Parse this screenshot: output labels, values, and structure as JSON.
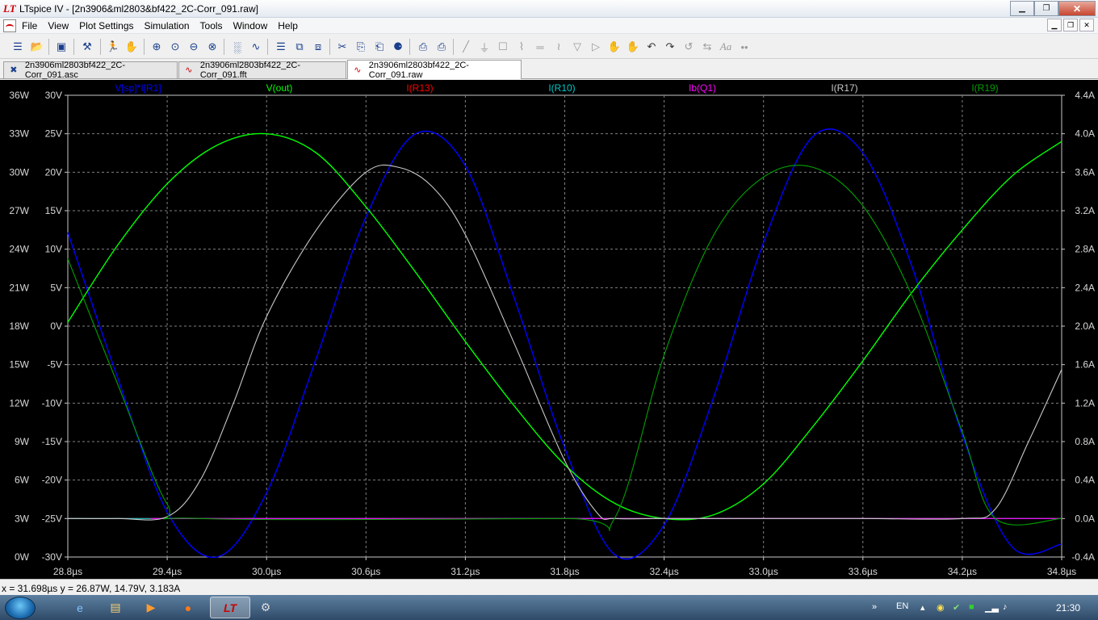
{
  "window": {
    "title": "LTspice IV - [2n3906&ml2803&bf422_2C-Corr_091.raw]",
    "app_icon": "ltspice-logo-icon"
  },
  "menu": {
    "items": [
      "File",
      "View",
      "Plot Settings",
      "Simulation",
      "Tools",
      "Window",
      "Help"
    ]
  },
  "tabs": [
    {
      "label": "2n3906ml2803bf422_2C-Corr_091.asc",
      "icon": "schematic-icon",
      "active": false
    },
    {
      "label": "2n3906ml2803bf422_2C-Corr_091.fft",
      "icon": "waveform-icon",
      "active": false
    },
    {
      "label": "2n3906ml2803bf422_2C-Corr_091.raw",
      "icon": "waveform-icon",
      "active": true
    }
  ],
  "status": {
    "cursor": "x = 31.698µs    y = 26.87W, 14.79V, 3.183A"
  },
  "taskbar": {
    "language": "EN",
    "clock": "21:30"
  },
  "chart_data": {
    "type": "line",
    "background": "#000000",
    "grid": true,
    "xlim": [
      28.8,
      34.8
    ],
    "xlabel": "",
    "x_ticks": [
      "28.8µs",
      "29.4µs",
      "30.0µs",
      "30.6µs",
      "31.2µs",
      "31.8µs",
      "32.4µs",
      "33.0µs",
      "33.6µs",
      "34.2µs",
      "34.8µs"
    ],
    "y_axes": {
      "watts": {
        "ticks": [
          "36W",
          "33W",
          "30W",
          "27W",
          "24W",
          "21W",
          "18W",
          "15W",
          "12W",
          "9W",
          "6W",
          "3W",
          "0W"
        ],
        "range": [
          0,
          36
        ]
      },
      "volts": {
        "ticks": [
          "30V",
          "25V",
          "20V",
          "15V",
          "10V",
          "5V",
          "0V",
          "-5V",
          "-10V",
          "-15V",
          "-20V",
          "-25V",
          "-30V"
        ],
        "range": [
          -30,
          30
        ]
      },
      "amps": {
        "ticks": [
          "4.4A",
          "4.0A",
          "3.6A",
          "3.2A",
          "2.8A",
          "2.4A",
          "2.0A",
          "1.6A",
          "1.2A",
          "0.8A",
          "0.4A",
          "0.0A",
          "-0.4A"
        ],
        "range": [
          -0.4,
          4.4
        ]
      }
    },
    "legend_placement": "top",
    "series": [
      {
        "name": "V[sp]*I[R1]",
        "color": "#0000ff",
        "unit": "W",
        "x": [
          28.8,
          29.1,
          29.4,
          29.7,
          30.0,
          30.3,
          30.6,
          30.9,
          31.2,
          31.5,
          31.8,
          32.1,
          32.4,
          32.7,
          33.0,
          33.3,
          33.6,
          33.9,
          34.2,
          34.5,
          34.8
        ],
        "values": [
          25.3,
          14.0,
          3.5,
          0.0,
          5.0,
          15.5,
          26.5,
          33.0,
          30.5,
          20.0,
          8.5,
          0.2,
          2.5,
          12.5,
          24.5,
          32.8,
          31.5,
          22.5,
          9.5,
          0.8,
          1.0
        ]
      },
      {
        "name": "V(out)",
        "color": "#00ff00",
        "unit": "V",
        "x": [
          28.8,
          29.1,
          29.4,
          29.7,
          30.0,
          30.3,
          30.6,
          30.9,
          31.2,
          31.5,
          31.8,
          32.1,
          32.4,
          32.7,
          33.0,
          33.3,
          33.6,
          33.9,
          34.2,
          34.5,
          34.8
        ],
        "values": [
          0.5,
          10.5,
          18.5,
          23.5,
          25.0,
          22.5,
          15.5,
          7.0,
          -2.0,
          -10.5,
          -18.0,
          -23.0,
          -25.0,
          -24.5,
          -20.5,
          -13.0,
          -4.5,
          4.5,
          12.5,
          19.5,
          24.0
        ]
      },
      {
        "name": "I(R13)",
        "color": "#ff0000",
        "unit": "A",
        "x": [
          28.8,
          34.8
        ],
        "values": [
          0.0,
          0.0
        ]
      },
      {
        "name": "I(R10)",
        "color": "#00c8c8",
        "unit": "A",
        "x": [
          28.8,
          34.8
        ],
        "values": [
          0.0,
          0.0
        ]
      },
      {
        "name": "Ib(Q1)",
        "color": "#ff00ff",
        "unit": "A",
        "x": [
          29.3,
          29.6,
          30.0,
          30.6,
          31.8,
          32.4,
          32.9,
          34.2,
          34.8
        ],
        "values": [
          0.0,
          0.0,
          0.0,
          0.0,
          0.0,
          0.0,
          0.0,
          0.0,
          0.0
        ]
      },
      {
        "name": "I(R17)",
        "color": "#c8c8c8",
        "unit": "A",
        "x": [
          28.8,
          29.1,
          29.4,
          29.6,
          29.8,
          30.0,
          30.3,
          30.6,
          30.8,
          31.0,
          31.2,
          31.5,
          31.8,
          32.0,
          32.1,
          32.4,
          33.0,
          33.6,
          34.2,
          34.4,
          34.6,
          34.8
        ],
        "values": [
          0.0,
          0.0,
          0.02,
          0.4,
          1.2,
          2.1,
          3.0,
          3.6,
          3.65,
          3.45,
          2.95,
          1.8,
          0.6,
          0.05,
          0.0,
          0.0,
          0.0,
          0.0,
          0.0,
          0.1,
          0.8,
          1.55
        ]
      },
      {
        "name": "I(R19)",
        "color": "#00a000",
        "unit": "A",
        "x": [
          28.8,
          29.1,
          29.4,
          29.6,
          31.8,
          32.1,
          32.4,
          32.7,
          33.0,
          33.3,
          33.6,
          33.9,
          34.2,
          34.4,
          34.8
        ],
        "values": [
          2.7,
          1.4,
          0.15,
          0.0,
          0.0,
          0.0,
          1.7,
          2.95,
          3.55,
          3.65,
          3.25,
          2.3,
          0.9,
          0.0,
          0.0
        ]
      }
    ]
  }
}
